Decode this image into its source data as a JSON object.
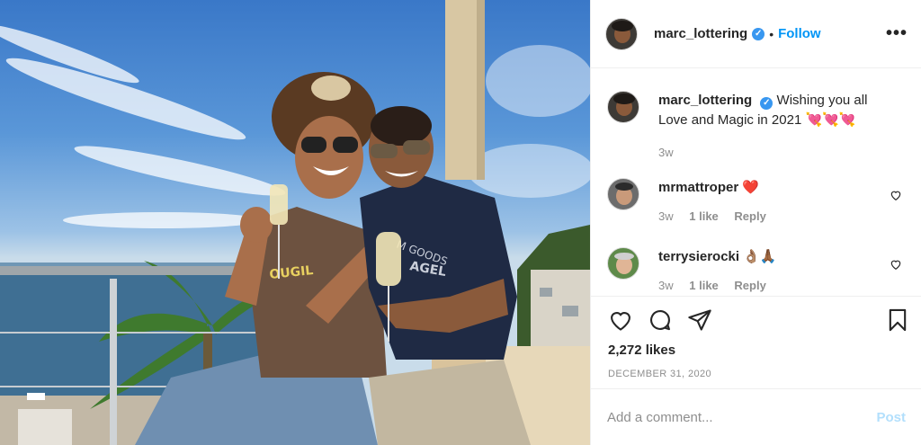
{
  "post": {
    "username": "marc_lottering",
    "verified_mark": "✓",
    "separator": "•",
    "follow_label": "Follow",
    "more_label": "•••",
    "caption_text": "Wishing you all Love and Magic in 2021 💘💘💘",
    "caption_time": "3w",
    "photo_description": "Two men in sunglasses holding champagne glasses on a balcony overlooking the sea"
  },
  "comments": [
    {
      "username": "mrmattroper",
      "text": "❤️",
      "time": "3w",
      "likes": "1 like",
      "reply": "Reply"
    },
    {
      "username": "terrysierocki",
      "text": "👌🏽🙏🏾",
      "time": "3w",
      "likes": "1 like",
      "reply": "Reply"
    }
  ],
  "actions": {
    "like_icon": "heart-icon",
    "comment_icon": "comment-bubble-icon",
    "share_icon": "paper-plane-icon",
    "save_icon": "bookmark-icon",
    "likes_count": "2,272 likes",
    "date": "DECEMBER 31, 2020"
  },
  "add_comment": {
    "placeholder": "Add a comment...",
    "post_label": "Post"
  },
  "colors": {
    "accent": "#0095f6",
    "verified": "#3897f0",
    "muted": "#8e8e8e",
    "post_disabled": "#b2dffc",
    "heart_red": "#ed4956"
  }
}
